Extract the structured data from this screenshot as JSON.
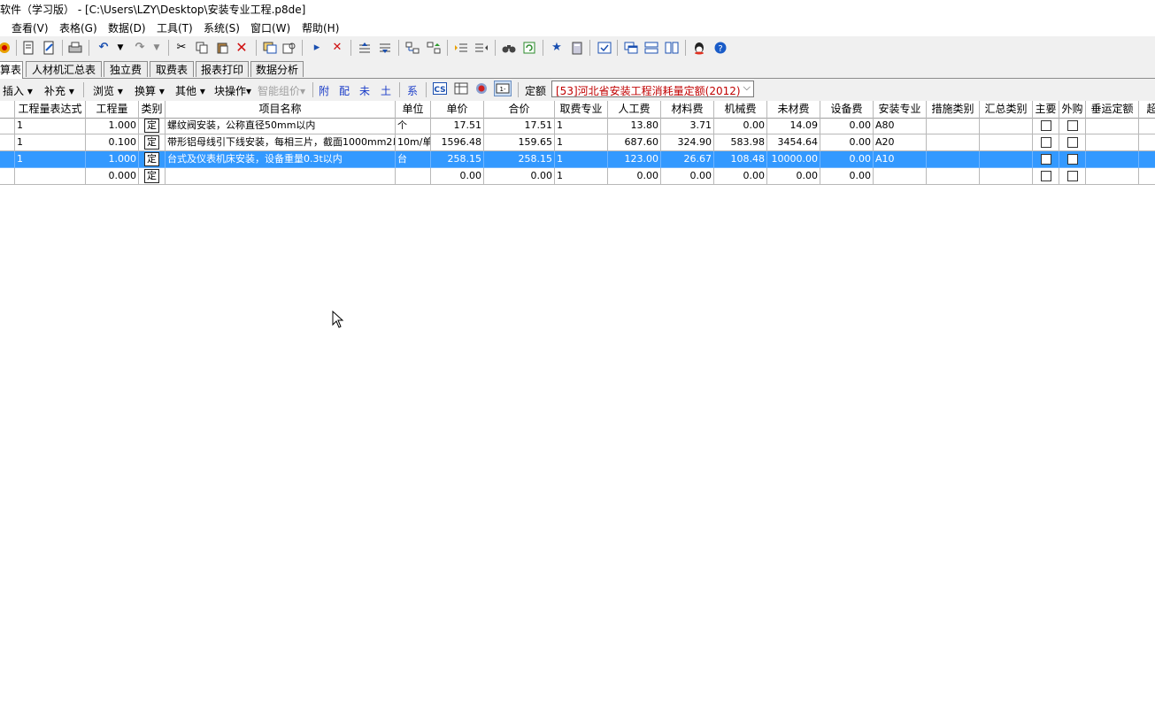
{
  "window": {
    "title": "软件（学习版） - [C:\\Users\\LZY\\Desktop\\安装专业工程.p8de]"
  },
  "menu": [
    "查看(V)",
    "表格(G)",
    "数据(D)",
    "工具(T)",
    "系统(S)",
    "窗口(W)",
    "帮助(H)"
  ],
  "tabs": [
    "算表",
    "人材机汇总表",
    "独立费",
    "取费表",
    "报表打印",
    "数据分析"
  ],
  "toolbar2": {
    "insert": "插入",
    "supplement": "补充",
    "browse": "浏览",
    "convert": "换算",
    "other": "其他",
    "block_ops": "块操作",
    "smart_group": "智能组价",
    "fu": "附",
    "pei": "配",
    "wei": "未",
    "tu": "土",
    "xi": "系",
    "quota_label": "定额",
    "quota_value": "[53]河北省安装工程消耗量定额(2012)"
  },
  "columns": [
    "工程量表达式",
    "工程量",
    "类别",
    "项目名称",
    "单位",
    "单价",
    "合价",
    "取费专业",
    "人工费",
    "材料费",
    "机械费",
    "未材费",
    "设备费",
    "安装专业",
    "措施类别",
    "汇总类别",
    "主要",
    "外购",
    "垂运定额",
    "超"
  ],
  "rows": [
    {
      "expr": "1",
      "qty": "1.000",
      "type": "定",
      "name": "螺纹阀安装，公称直径50mm以内",
      "unit": "个",
      "price": "17.51",
      "total": "17.51",
      "fee_spec": "1",
      "labor": "13.80",
      "material": "3.71",
      "machine": "0.00",
      "unpriced": "14.09",
      "equipment": "0.00",
      "install": "A80",
      "measure": "",
      "summary": "",
      "vert": "",
      "selected": false
    },
    {
      "expr": "1",
      "qty": "0.100",
      "type": "定",
      "name": "带形铝母线引下线安装，每相三片，截面1000mm2以",
      "unit": "10m/单",
      "price": "1596.48",
      "total": "159.65",
      "fee_spec": "1",
      "labor": "687.60",
      "material": "324.90",
      "machine": "583.98",
      "unpriced": "3454.64",
      "equipment": "0.00",
      "install": "A20",
      "measure": "",
      "summary": "",
      "vert": "",
      "selected": false
    },
    {
      "expr": "1",
      "qty": "1.000",
      "type": "定",
      "name": "台式及仪表机床安装，设备重量0.3t以内",
      "unit": "台",
      "price": "258.15",
      "total": "258.15",
      "fee_spec": "1",
      "labor": "123.00",
      "material": "26.67",
      "machine": "108.48",
      "unpriced": "10000.00",
      "equipment": "0.00",
      "install": "A10",
      "measure": "",
      "summary": "",
      "vert": "",
      "selected": true
    },
    {
      "expr": "",
      "qty": "0.000",
      "type": "定",
      "name": "",
      "unit": "",
      "price": "0.00",
      "total": "0.00",
      "fee_spec": "1",
      "labor": "0.00",
      "material": "0.00",
      "machine": "0.00",
      "unpriced": "0.00",
      "equipment": "0.00",
      "install": "",
      "measure": "",
      "summary": "",
      "vert": "",
      "selected": false
    }
  ],
  "icons": [
    "app-icon",
    "new-icon",
    "edit-icon",
    "print-icon",
    "undo-icon",
    "redo-icon",
    "cut-icon",
    "copy-icon",
    "paste-icon",
    "delete-icon"
  ]
}
